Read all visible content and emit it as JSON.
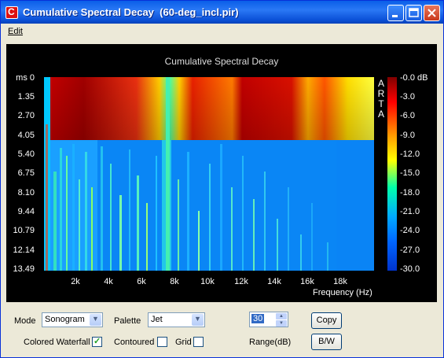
{
  "window": {
    "title": "Cumulative Spectral Decay  (60-deg_incl.pir)",
    "app_icon_letter": "C"
  },
  "menu": {
    "items": [
      {
        "label": "Edit"
      }
    ]
  },
  "chart": {
    "title": "Cumulative Spectral Decay",
    "y_ticks": [
      "ms 0",
      "1.35",
      "2.70",
      "4.05",
      "5.40",
      "6.75",
      "8.10",
      "9.44",
      "10.79",
      "12.14",
      "13.49"
    ],
    "x_ticks": [
      "2k",
      "4k",
      "6k",
      "8k",
      "10k",
      "12k",
      "14k",
      "16k",
      "18k"
    ],
    "x_title": "Frequency (Hz)",
    "watermark": [
      "A",
      "R",
      "T",
      "A"
    ],
    "colorbar_ticks": [
      "-0.0 dB",
      "-3.0",
      "-6.0",
      "-9.0",
      "-12.0",
      "-15.0",
      "-18.0",
      "-21.0",
      "-24.0",
      "-27.0",
      "-30.0"
    ],
    "palette_colors": [
      "#800000",
      "#ff0000",
      "#ff9900",
      "#ffff00",
      "#00ffaa",
      "#00aaff",
      "#0066ff",
      "#0033cc"
    ]
  },
  "controls": {
    "mode_label": "Mode",
    "mode_value": "Sonogram",
    "palette_label": "Palette",
    "palette_value": "Jet",
    "range_value": "30",
    "range_label": "Range(dB)",
    "copy_label": "Copy",
    "bw_label": "B/W",
    "colored_waterfall_label": "Colored Waterfall",
    "colored_waterfall_checked": true,
    "contoured_label": "Contoured",
    "contoured_checked": false,
    "grid_label": "Grid",
    "grid_checked": false
  }
}
